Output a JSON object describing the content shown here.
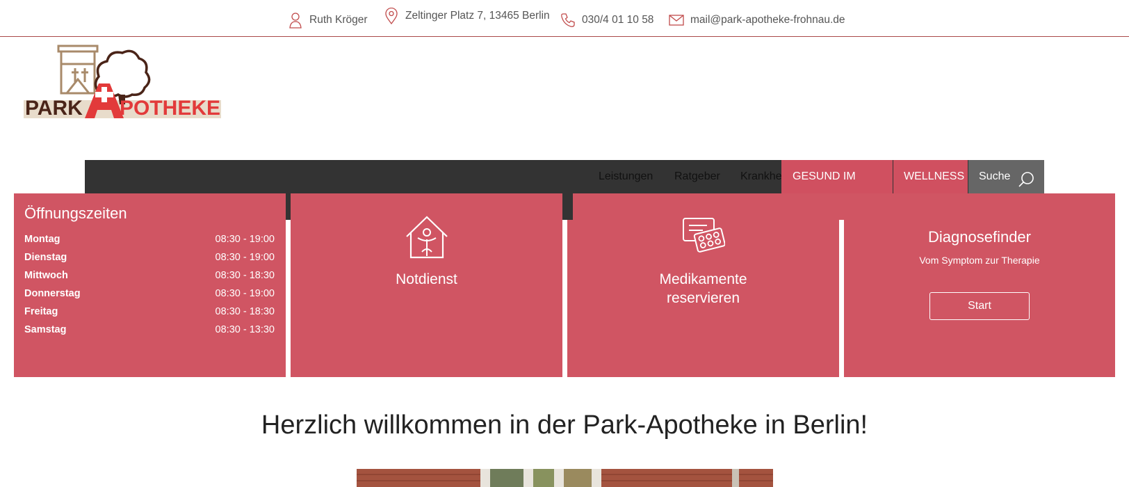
{
  "topbar": {
    "person": "Ruth Kröger",
    "address": "Zeltinger Platz 7, 13465 Berlin",
    "phone": "030/4 01 10 58",
    "email": "mail@park-apotheke-frohnau.de"
  },
  "logo": {
    "text_park": "PARK",
    "text_apotheke": "APOTHEKE"
  },
  "nav": {
    "items": [
      "Leistungen",
      "Ratgeber",
      "Krankheiten &"
    ],
    "gesund": "GESUND IM",
    "wellness": "WELLNESS",
    "search": "Suche"
  },
  "hours": {
    "title": "Öffnungszeiten",
    "rows": [
      {
        "day": "Montag",
        "time": "08:30 - 19:00"
      },
      {
        "day": "Dienstag",
        "time": "08:30 - 19:00"
      },
      {
        "day": "Mittwoch",
        "time": "08:30 - 18:30"
      },
      {
        "day": "Donnerstag",
        "time": "08:30 - 19:00"
      },
      {
        "day": "Freitag",
        "time": "08:30 - 18:30"
      },
      {
        "day": "Samstag",
        "time": "08:30 - 13:30"
      }
    ]
  },
  "tiles": {
    "notdienst": "Notdienst",
    "medikamente_line1": "Medikamente",
    "medikamente_line2": "reservieren",
    "diag_title": "Diagnosefinder",
    "diag_sub": "Vom Symptom zur Therapie",
    "diag_button": "Start"
  },
  "welcome": "Herzlich willkommen in der Park-Apotheke in Berlin!",
  "colors": {
    "accent": "#d05563",
    "nav_dark": "#333333",
    "search_bg": "#666666",
    "border": "#a94848"
  }
}
